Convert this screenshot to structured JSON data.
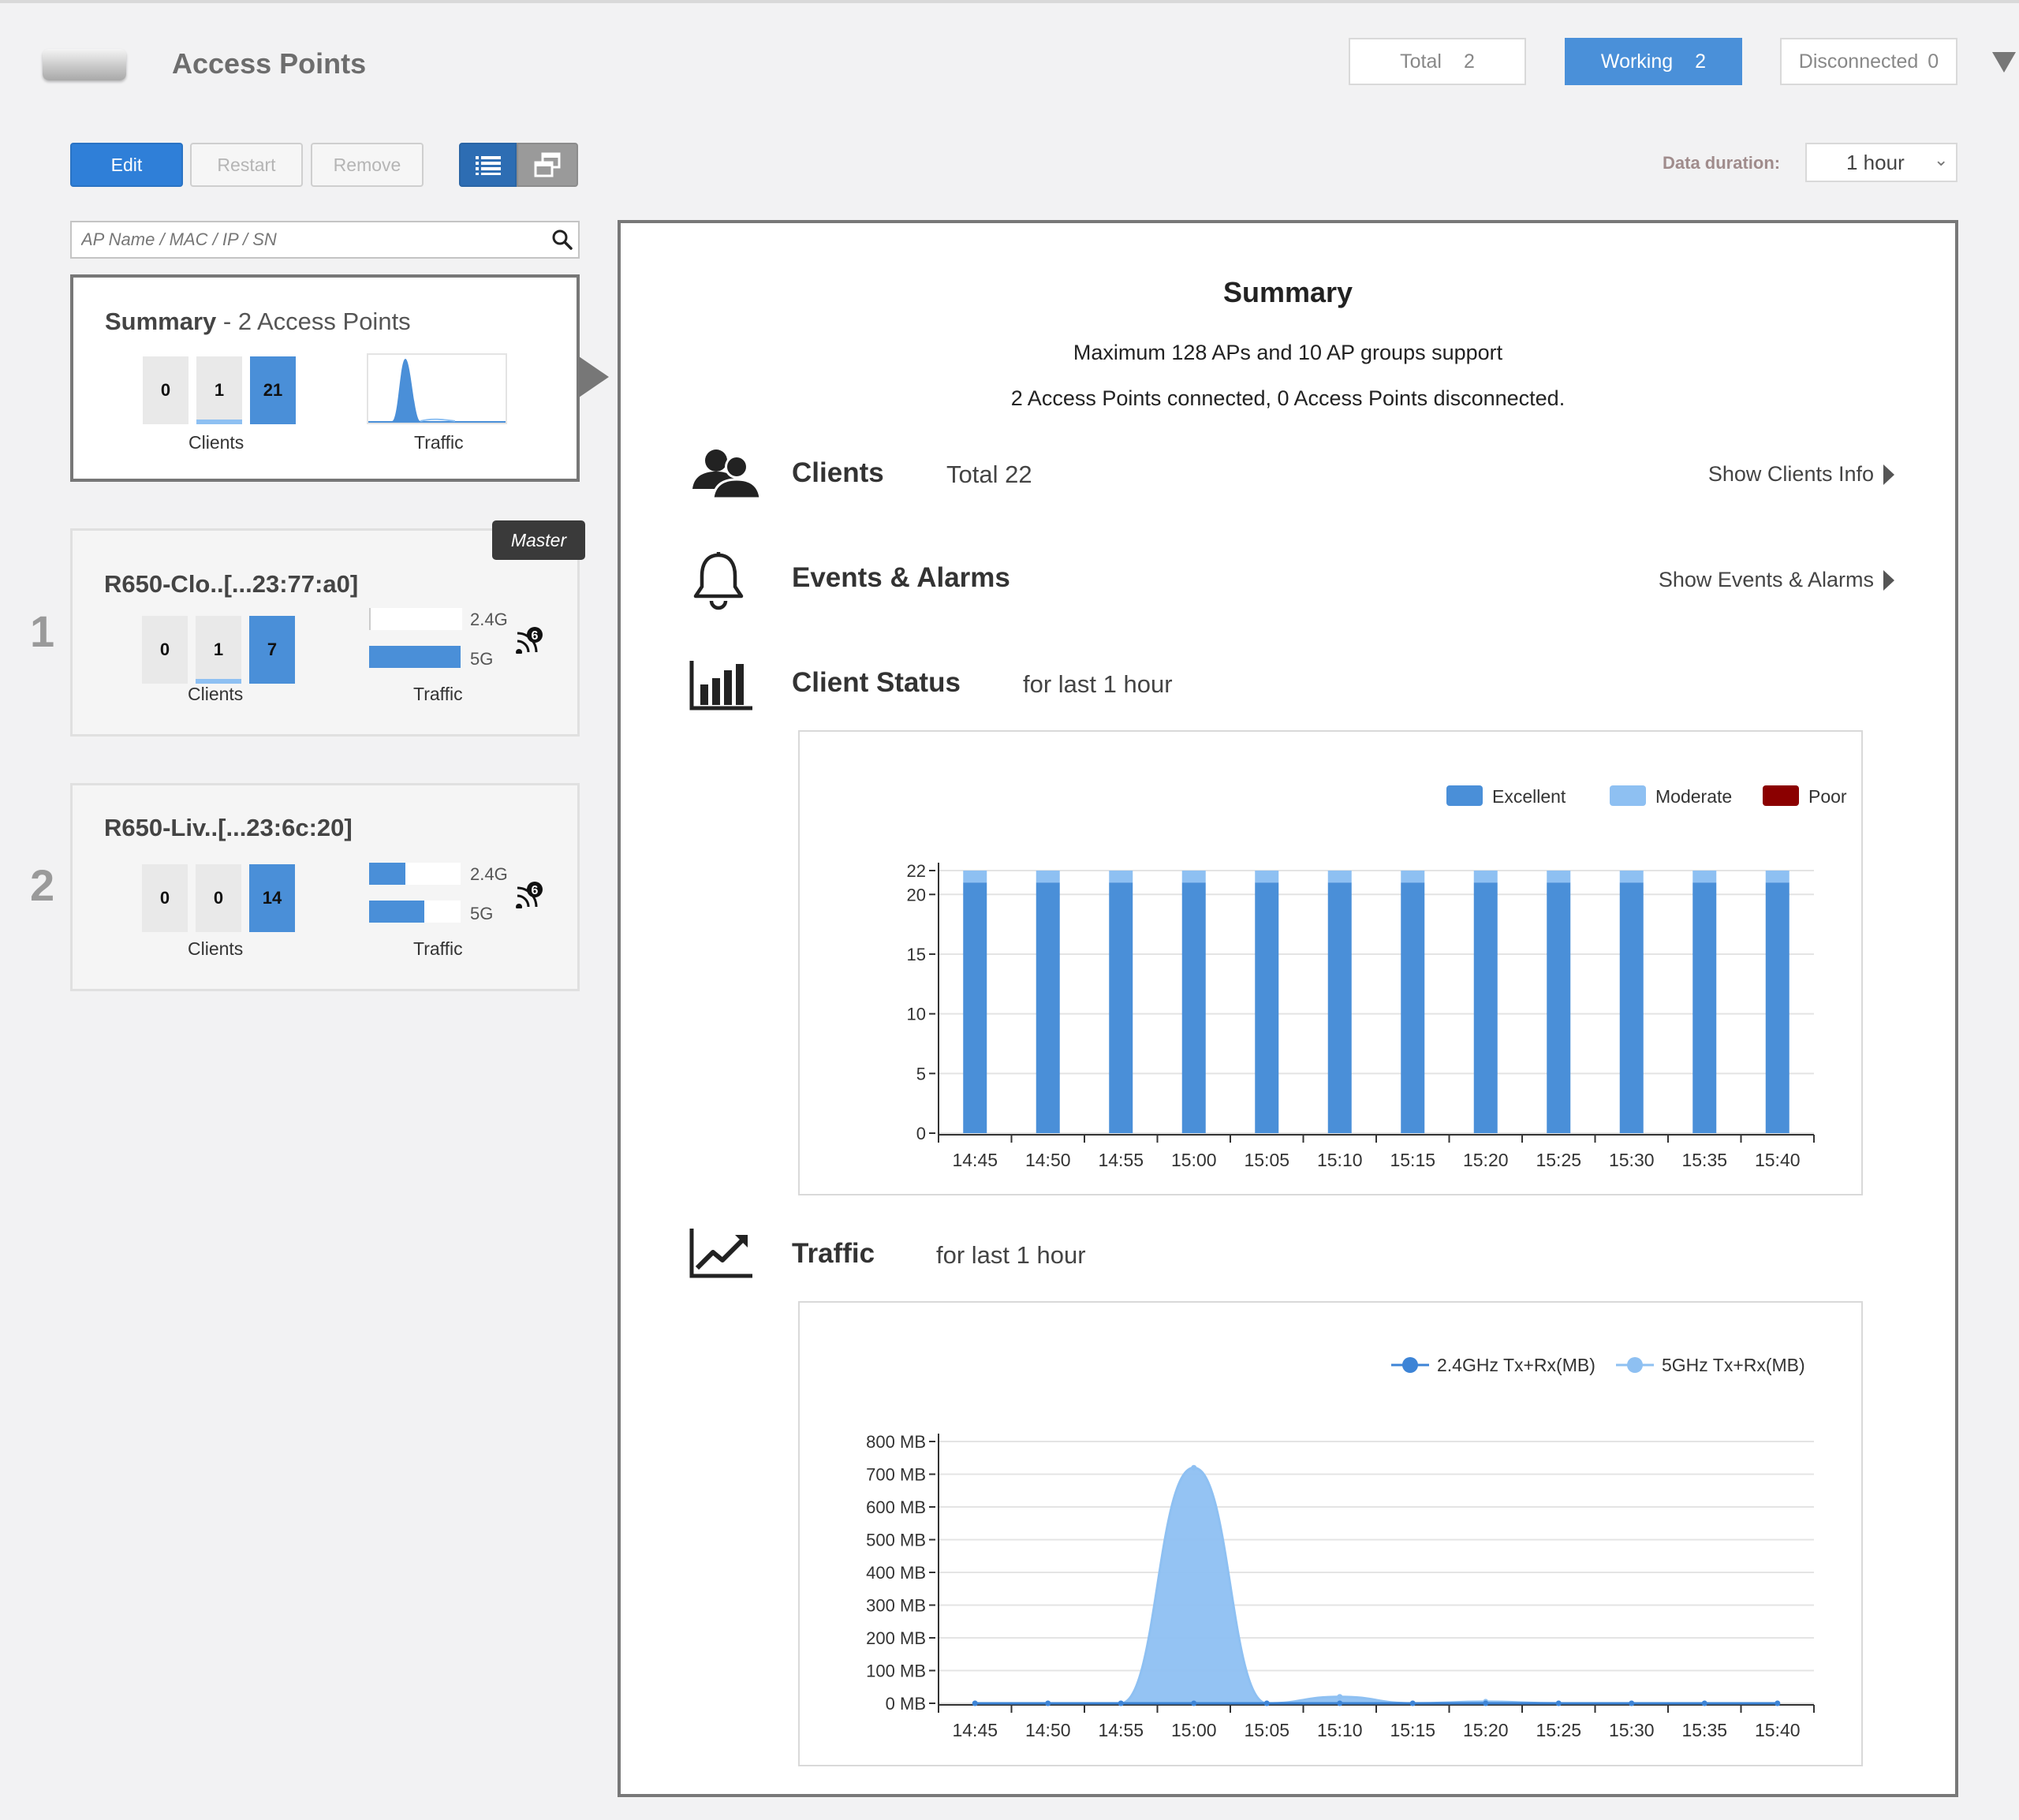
{
  "header": {
    "title": "Access Points",
    "stats": [
      {
        "label": "Total",
        "value": "2"
      },
      {
        "label": "Working",
        "value": "2"
      },
      {
        "label": "Disconnected",
        "value": "0"
      }
    ]
  },
  "toolbar": {
    "edit_label": "Edit",
    "restart_label": "Restart",
    "remove_label": "Remove",
    "data_duration_label": "Data duration:",
    "data_duration_value": "1 hour"
  },
  "search": {
    "placeholder": "AP Name / MAC / IP / SN",
    "value": ""
  },
  "summary_card": {
    "title_bold": "Summary",
    "title_rest": " - 2 Access Points",
    "clients": [
      "0",
      "1",
      "21"
    ],
    "clients_label": "Clients",
    "traffic_label": "Traffic"
  },
  "ap_list": [
    {
      "index": "1",
      "name": "R650-Clo..[...23:77:a0]",
      "badge": "Master",
      "clients": [
        "0",
        "1",
        "7"
      ],
      "clients_label": "Clients",
      "traffic_label": "Traffic",
      "band_24_label": "2.4G",
      "band_5_label": "5G",
      "band_24_fraction": 0.0,
      "band_5_fraction": 1.0
    },
    {
      "index": "2",
      "name": "R650-Liv..[...23:6c:20]",
      "clients": [
        "0",
        "0",
        "14"
      ],
      "clients_label": "Clients",
      "traffic_label": "Traffic",
      "band_24_label": "2.4G",
      "band_5_label": "5G",
      "band_24_fraction": 0.4,
      "band_5_fraction": 0.6
    }
  ],
  "summary_panel": {
    "heading": "Summary",
    "capacity": "Maximum 128 APs and 10 AP groups support",
    "connection": "2 Access Points connected, 0 Access Points disconnected.",
    "clients": {
      "title": "Clients",
      "total": "Total 22",
      "link": "Show Clients Info"
    },
    "events": {
      "title": "Events & Alarms",
      "link": "Show Events & Alarms"
    },
    "client_status": {
      "title": "Client Status",
      "subtitle": "for last 1 hour"
    },
    "traffic": {
      "title": "Traffic",
      "subtitle": "for last 1 hour"
    }
  },
  "colors": {
    "accent": "#2f7fd8",
    "excellent": "#4a8fd8",
    "moderate": "#8ec0f2",
    "poor": "#8b0000",
    "series_24": "#3d84d6",
    "series_5": "#8ec0f2"
  },
  "chart_data": [
    {
      "type": "bar",
      "title": "",
      "stacked": true,
      "categories": [
        "14:45",
        "14:50",
        "14:55",
        "15:00",
        "15:05",
        "15:10",
        "15:15",
        "15:20",
        "15:25",
        "15:30",
        "15:35",
        "15:40"
      ],
      "series": [
        {
          "name": "Excellent",
          "values": [
            21,
            21,
            21,
            21,
            21,
            21,
            21,
            21,
            21,
            21,
            21,
            21
          ]
        },
        {
          "name": "Moderate",
          "values": [
            1,
            1,
            1,
            1,
            1,
            1,
            1,
            1,
            1,
            1,
            1,
            1
          ]
        },
        {
          "name": "Poor",
          "values": [
            0,
            0,
            0,
            0,
            0,
            0,
            0,
            0,
            0,
            0,
            0,
            0
          ]
        }
      ],
      "yticks": [
        0,
        5,
        10,
        15,
        20,
        22
      ],
      "ylim": [
        0,
        22
      ],
      "legend_position": "top-right",
      "grid": true
    },
    {
      "type": "area",
      "title": "",
      "categories": [
        "14:45",
        "14:50",
        "14:55",
        "15:00",
        "15:05",
        "15:10",
        "15:15",
        "15:20",
        "15:25",
        "15:30",
        "15:35",
        "15:40"
      ],
      "series": [
        {
          "name": "2.4GHz Tx+Rx(MB)",
          "values": [
            0,
            0,
            0,
            0,
            0,
            0,
            0,
            0,
            0,
            0,
            0,
            0
          ]
        },
        {
          "name": "5GHz Tx+Rx(MB)",
          "values": [
            0,
            0,
            0,
            720,
            0,
            20,
            0,
            5,
            0,
            0,
            0,
            0
          ]
        }
      ],
      "yticks": [
        "0 MB",
        "100 MB",
        "200 MB",
        "300 MB",
        "400 MB",
        "500 MB",
        "600 MB",
        "700 MB",
        "800 MB"
      ],
      "ylim": [
        0,
        800
      ],
      "legend_position": "top-right",
      "grid": true
    }
  ]
}
